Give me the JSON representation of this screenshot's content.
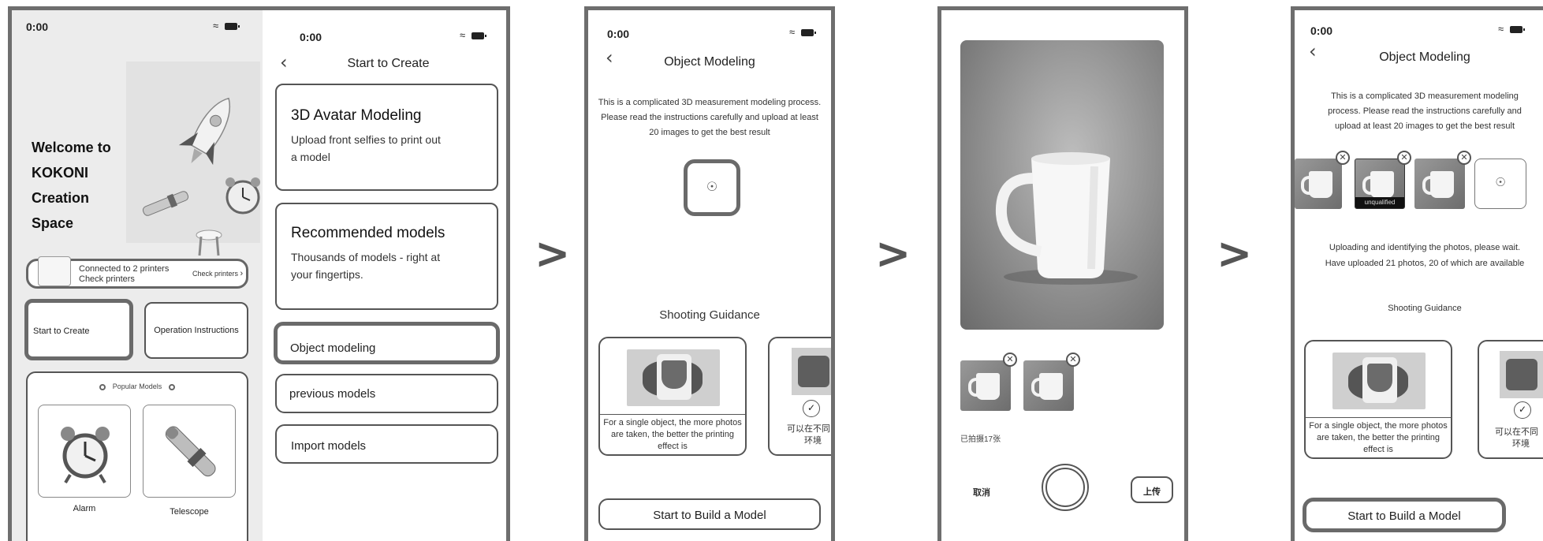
{
  "status_time": "0:00",
  "screen1": {
    "welcome": [
      "Welcome to",
      "KOKONI",
      "Creation",
      "Space"
    ],
    "printers_line1": "Connected to 2 printers",
    "printers_line2": "Check printers",
    "check_printers": "Check printers",
    "start_create": "Start to Create",
    "operation_instructions": "Operation Instructions",
    "popular_models": "Popular Models",
    "models": [
      "Alarm",
      "Telescope"
    ]
  },
  "screen2": {
    "title": "Start to Create",
    "avatar_title": "3D Avatar Modeling",
    "avatar_desc": [
      "Upload front selfies to print out",
      "a model"
    ],
    "recommended_title": "Recommended models",
    "recommended_desc": [
      "Thousands of models - right at",
      "your fingertips."
    ],
    "object_modeling": "Object modeling",
    "previous_models": "previous models",
    "import_models": "Import models"
  },
  "arrow_glyph": ">",
  "screen3": {
    "title": "Object Modeling",
    "description": [
      "This is a complicated 3D measurement modeling process.",
      "Please read the instructions carefully and upload at least",
      "20 images to get the best result"
    ],
    "shooting_guidance": "Shooting Guidance",
    "guide_text": [
      "For a single object, the more photos",
      "are taken, the better the printing",
      "effect is"
    ],
    "guide2_text": [
      "可以在不同",
      "环境"
    ],
    "build_button": "Start to Build a Model"
  },
  "screen4": {
    "photo_count": "已拍摄17张",
    "cancel": "取消",
    "upload": "上传"
  },
  "screen5": {
    "title": "Object Modeling",
    "description": [
      "This is a complicated 3D measurement modeling",
      "process. Please read the instructions carefully and",
      "upload at least 20 images to get the best result"
    ],
    "unqualified": "unqualified",
    "status": [
      "Uploading and identifying the photos, please wait.",
      "Have uploaded 21 photos, 20 of which are available"
    ],
    "shooting_guidance": "Shooting Guidance",
    "guide_text": [
      "For a single object, the more photos",
      "are taken, the better the printing",
      "effect is"
    ],
    "guide2_text": [
      "可以在不同",
      "环境"
    ],
    "build_button": "Start to Build a Model"
  }
}
